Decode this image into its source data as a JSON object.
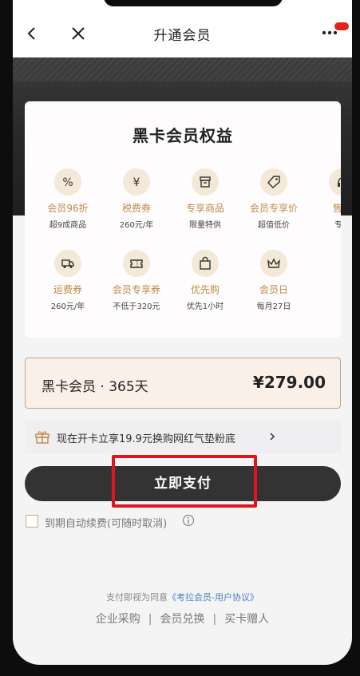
{
  "nav": {
    "title": "升通会员",
    "back_icon": "chevron-left-icon",
    "close_icon": "close-icon",
    "more_icon": "more-dots-icon"
  },
  "card": {
    "title": "黑卡会员权益",
    "row1": [
      {
        "icon": "percent-icon",
        "name": "会员96折",
        "desc": "超9成商品"
      },
      {
        "icon": "yen-icon",
        "name": "税费券",
        "desc": "260元/年"
      },
      {
        "icon": "box-icon",
        "name": "专享商品",
        "desc": "限量特供"
      },
      {
        "icon": "tag-icon",
        "name": "会员专享价",
        "desc": "超值低价"
      },
      {
        "icon": "headset-icon",
        "name": "售后",
        "desc": "专属"
      }
    ],
    "row2": [
      {
        "icon": "truck-icon",
        "name": "运费券",
        "desc": "260元/年"
      },
      {
        "icon": "ticket-icon",
        "name": "会员专享券",
        "desc": "不低于320元"
      },
      {
        "icon": "bag-icon",
        "name": "优先购",
        "desc": "优先1小时"
      },
      {
        "icon": "crown-icon",
        "name": "会员日",
        "desc": "每月27日"
      }
    ]
  },
  "plan": {
    "name": "黑卡会员 · 365天",
    "price": "¥279.00"
  },
  "promo": {
    "text": "现在开卡立享19.9元换购网红气垫粉底",
    "icon": "gift-icon"
  },
  "pay_button": "立即支付",
  "renew": {
    "label": "到期自动续费(可随时取消)"
  },
  "footer": {
    "agree_prefix": "支付即视为同意",
    "agree_link": "《考拉会员-用户协议》",
    "links": [
      "企业采购",
      "会员兑换",
      "买卡赠人"
    ]
  },
  "colors": {
    "accent_gold": "#c08a4a",
    "highlight_red": "#e0141e",
    "button_dark": "#333333"
  }
}
